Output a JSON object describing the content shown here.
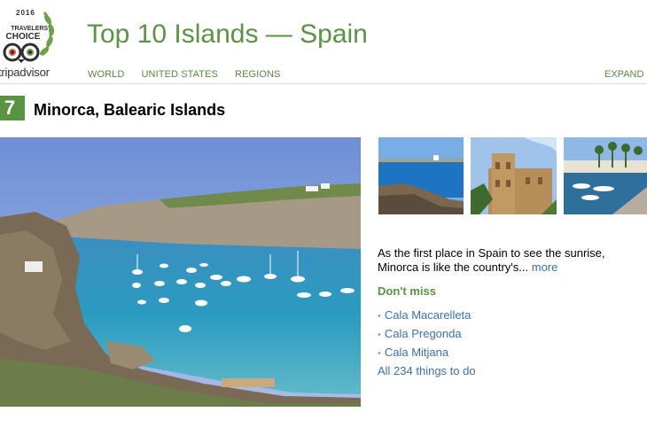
{
  "logo": {
    "year": "2016",
    "award_line1": "TRAVELERS'",
    "award_line2": "CHOICE",
    "wordmark": "tripadvisor"
  },
  "page": {
    "title": "Top 10 Islands — Spain"
  },
  "nav": {
    "items": [
      "WORLD",
      "UNITED STATES",
      "REGIONS"
    ],
    "expand": "EXPAND L"
  },
  "entry": {
    "rank": "7",
    "name": "Minorca, Balearic Islands",
    "description": "As the first place in Spain to see the sunrise, Minorca is like the country's...",
    "more_label": "more",
    "dont_miss_label": "Don't miss",
    "dont_miss": [
      "Cala Macarelleta",
      "Cala Pregonda",
      "Cala Mitjana"
    ],
    "all_things": "All 234 things to do"
  },
  "colors": {
    "brand_green": "#589442",
    "link_blue": "#3a6fb7"
  }
}
